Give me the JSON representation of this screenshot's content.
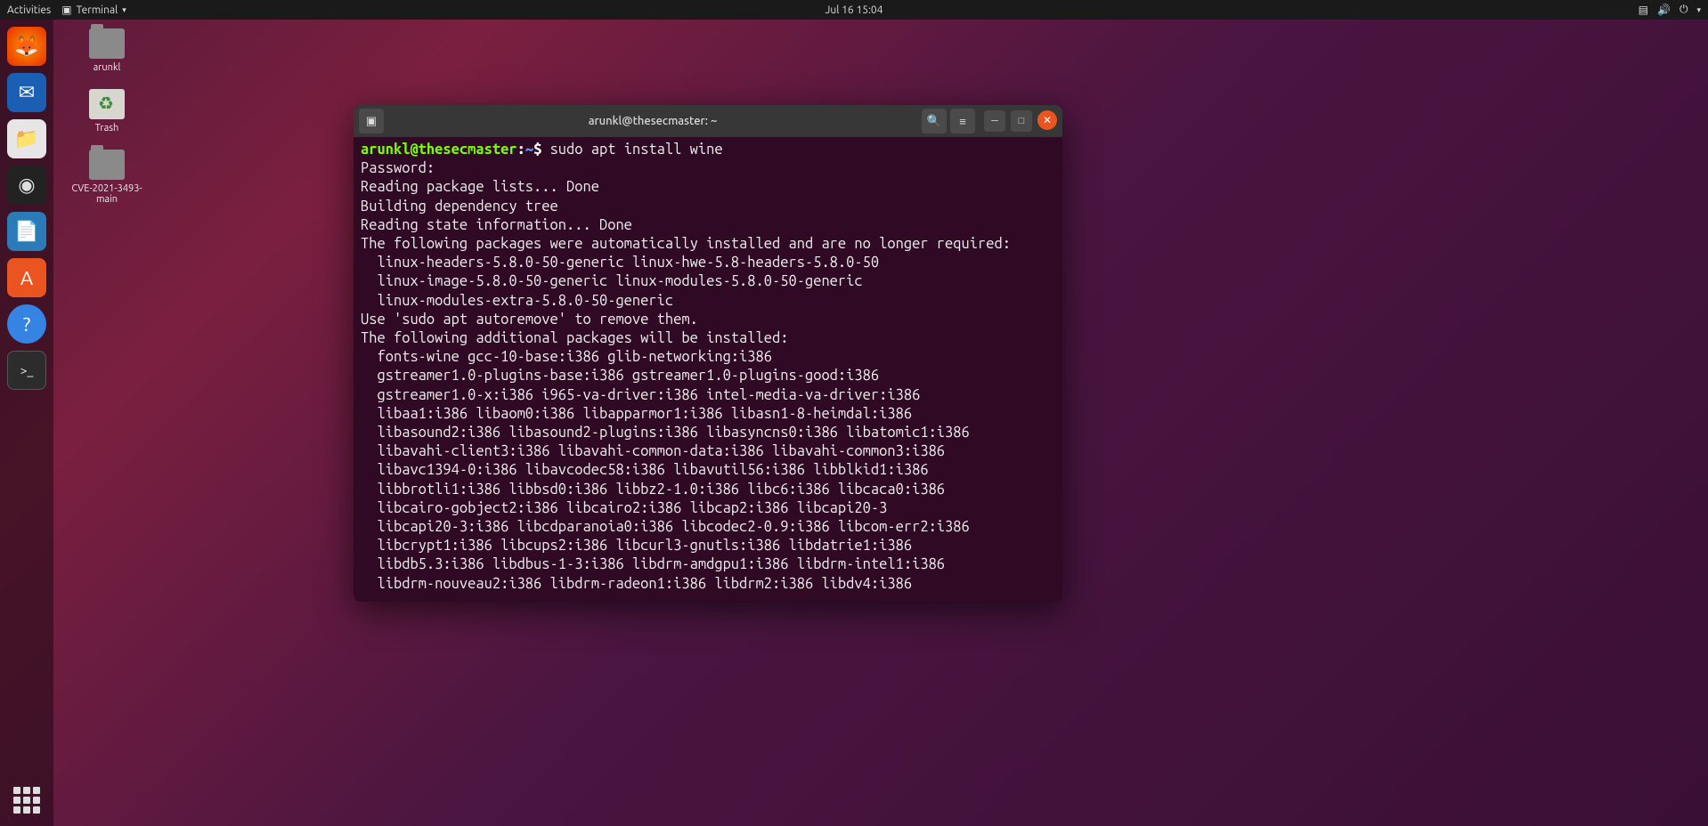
{
  "topbar": {
    "activities": "Activities",
    "app_label": "Terminal",
    "datetime": "Jul 16  15:04"
  },
  "desktop_icons": [
    {
      "label": "arunkl",
      "kind": "folder"
    },
    {
      "label": "Trash",
      "kind": "trash"
    },
    {
      "label": "CVE-2021-3493-main",
      "kind": "folder"
    }
  ],
  "dock_icons": [
    "firefox",
    "thunderbird",
    "files",
    "rhythmbox",
    "libreoffice-writer",
    "ubuntu-software",
    "help",
    "terminal"
  ],
  "terminal": {
    "title": "arunkl@thesecmaster: ~",
    "prompt_user": "arunkl@thesecmaster",
    "prompt_sep": ":",
    "prompt_path": "~",
    "prompt_sym": "$",
    "command": "sudo apt install wine",
    "output": "Password:\nReading package lists... Done\nBuilding dependency tree\nReading state information... Done\nThe following packages were automatically installed and are no longer required:\n  linux-headers-5.8.0-50-generic linux-hwe-5.8-headers-5.8.0-50\n  linux-image-5.8.0-50-generic linux-modules-5.8.0-50-generic\n  linux-modules-extra-5.8.0-50-generic\nUse 'sudo apt autoremove' to remove them.\nThe following additional packages will be installed:\n  fonts-wine gcc-10-base:i386 glib-networking:i386\n  gstreamer1.0-plugins-base:i386 gstreamer1.0-plugins-good:i386\n  gstreamer1.0-x:i386 i965-va-driver:i386 intel-media-va-driver:i386\n  libaa1:i386 libaom0:i386 libapparmor1:i386 libasn1-8-heimdal:i386\n  libasound2:i386 libasound2-plugins:i386 libasyncns0:i386 libatomic1:i386\n  libavahi-client3:i386 libavahi-common-data:i386 libavahi-common3:i386\n  libavc1394-0:i386 libavcodec58:i386 libavutil56:i386 libblkid1:i386\n  libbrotli1:i386 libbsd0:i386 libbz2-1.0:i386 libc6:i386 libcaca0:i386\n  libcairo-gobject2:i386 libcairo2:i386 libcap2:i386 libcapi20-3\n  libcapi20-3:i386 libcdparanoia0:i386 libcodec2-0.9:i386 libcom-err2:i386\n  libcrypt1:i386 libcups2:i386 libcurl3-gnutls:i386 libdatrie1:i386\n  libdb5.3:i386 libdbus-1-3:i386 libdrm-amdgpu1:i386 libdrm-intel1:i386\n  libdrm-nouveau2:i386 libdrm-radeon1:i386 libdrm2:i386 libdv4:i386"
  }
}
